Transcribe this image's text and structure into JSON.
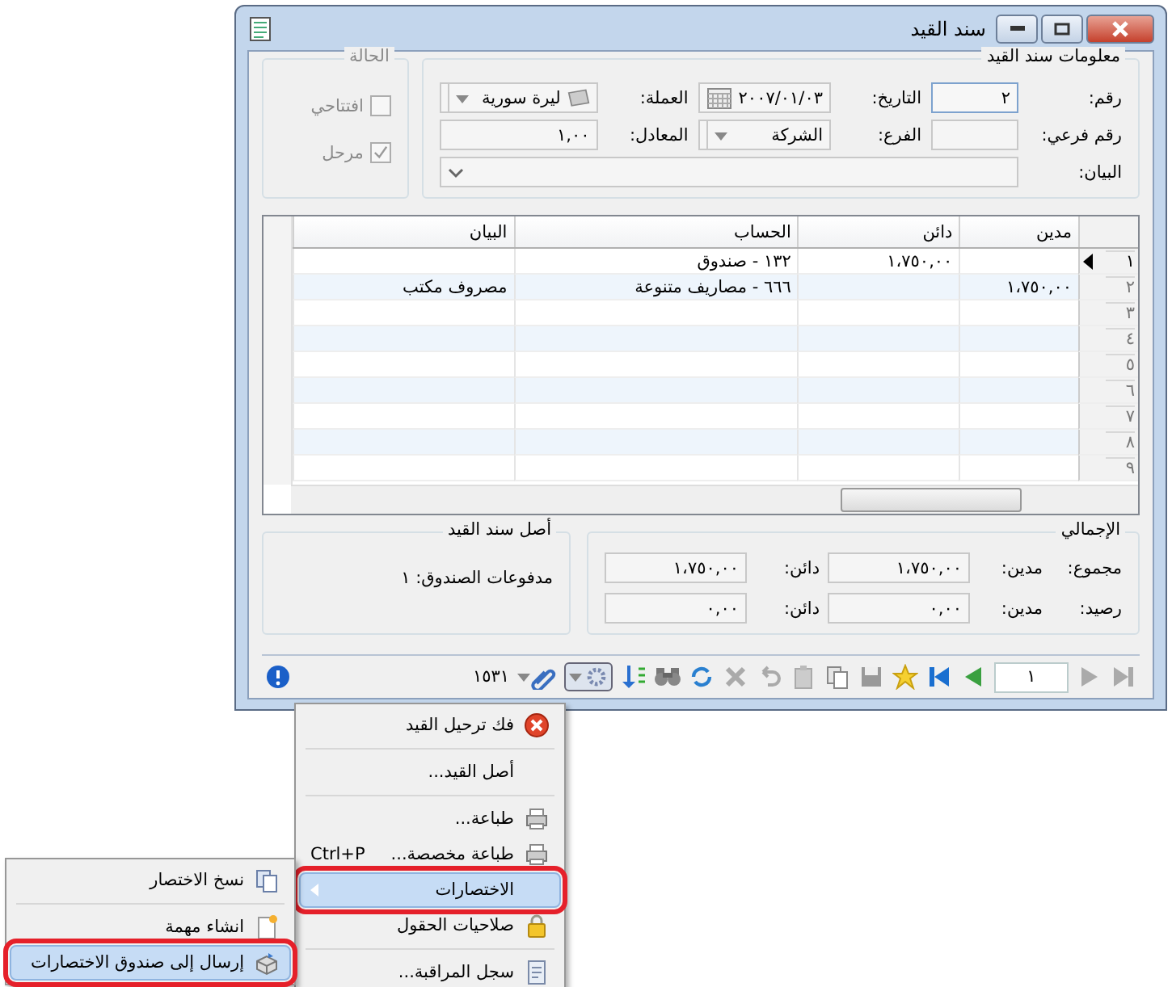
{
  "window": {
    "title": "سند القيد"
  },
  "info_group": {
    "title": "معلومات سند القيد",
    "number_label": "رقم:",
    "number": "٢",
    "date_label": "التاريخ:",
    "date": "٢٠٠٧/٠١/٠٣",
    "currency_label": "العملة:",
    "currency": "ليرة سورية",
    "sub_number_label": "رقم فرعي:",
    "branch_label": "الفرع:",
    "branch": "الشركة",
    "rate_label": "المعادل:",
    "rate": "١,٠٠",
    "description_label": "البيان:"
  },
  "status_group": {
    "title": "الحالة",
    "checkboxes": [
      {
        "label": "افتتاحي",
        "checked": false
      },
      {
        "label": "مرحل",
        "checked": true
      }
    ]
  },
  "grid": {
    "columns": [
      "مدين",
      "دائن",
      "الحساب",
      "البيان"
    ],
    "rows": [
      {
        "number": "١",
        "current": true,
        "cells": [
          "",
          "١،٧٥٠,٠٠",
          "١٣٢ - صندوق",
          ""
        ]
      },
      {
        "number": "٢",
        "current": false,
        "cells": [
          "١،٧٥٠,٠٠",
          "",
          "٦٦٦ - مصاريف متنوعة",
          "مصروف مكتب"
        ]
      },
      {
        "number": "٣",
        "current": false,
        "cells": [
          "",
          "",
          "",
          ""
        ]
      },
      {
        "number": "٤",
        "current": false,
        "cells": [
          "",
          "",
          "",
          ""
        ]
      },
      {
        "number": "٥",
        "current": false,
        "cells": [
          "",
          "",
          "",
          ""
        ]
      },
      {
        "number": "٦",
        "current": false,
        "cells": [
          "",
          "",
          "",
          ""
        ]
      },
      {
        "number": "٧",
        "current": false,
        "cells": [
          "",
          "",
          "",
          ""
        ]
      },
      {
        "number": "٨",
        "current": false,
        "cells": [
          "",
          "",
          "",
          ""
        ]
      },
      {
        "number": "٩",
        "current": false,
        "cells": [
          "",
          "",
          "",
          ""
        ]
      }
    ]
  },
  "totals": {
    "title": "الإجمالي",
    "rows": [
      {
        "label": "مجموع:",
        "debit_label": "مدين:",
        "debit": "١،٧٥٠,٠٠",
        "credit_label": "دائن:",
        "credit": "١،٧٥٠,٠٠"
      },
      {
        "label": "رصيد:",
        "debit_label": "مدين:",
        "debit": "٠,٠٠",
        "credit_label": "دائن:",
        "credit": "٠,٠٠"
      }
    ]
  },
  "origin": {
    "title": "أصل سند القيد",
    "text": "مدفوعات الصندوق: ١"
  },
  "toolbar": {
    "record": "١",
    "count": "١٥٣١"
  },
  "menu": {
    "items": [
      {
        "kind": "item",
        "label": "فك ترحيل القيد",
        "selected": false,
        "annotated": false
      },
      {
        "kind": "separator"
      },
      {
        "kind": "item",
        "label": "أصل القيد...",
        "selected": false,
        "annotated": false
      },
      {
        "kind": "separator"
      },
      {
        "kind": "item",
        "label": "طباعة...",
        "selected": false,
        "annotated": false
      },
      {
        "kind": "item",
        "label": "طباعة مخصصة...",
        "shortcut": "Ctrl+P",
        "selected": false,
        "annotated": false
      },
      {
        "kind": "submenu",
        "label": "الاختصارات",
        "selected": true,
        "annotated": true
      },
      {
        "kind": "item",
        "label": "صلاحيات الحقول",
        "selected": false,
        "annotated": false
      },
      {
        "kind": "separator"
      },
      {
        "kind": "item",
        "label": "سجل المراقبة...",
        "selected": false,
        "annotated": false
      }
    ]
  },
  "submenu": {
    "items": [
      {
        "kind": "item",
        "label": "نسخ الاختصار",
        "selected": false,
        "annotated": false
      },
      {
        "kind": "separator"
      },
      {
        "kind": "item",
        "label": "انشاء مهمة",
        "selected": false,
        "annotated": false
      },
      {
        "kind": "item",
        "label": "إرسال إلى صندوق الاختصارات",
        "selected": true,
        "annotated": true
      }
    ]
  }
}
